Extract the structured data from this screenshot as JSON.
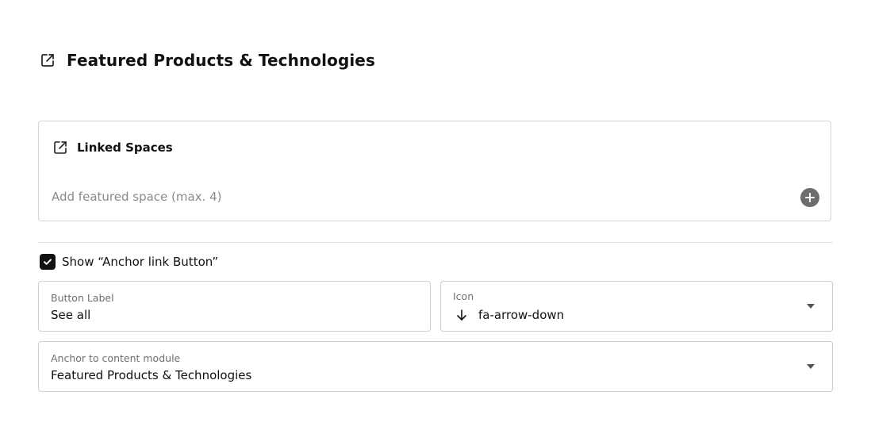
{
  "header": {
    "icon": "external-link-icon",
    "title": "Featured Products & Technologies"
  },
  "linked_spaces": {
    "icon": "external-link-icon",
    "title": "Linked Spaces",
    "placeholder": "Add featured space (max. 4)",
    "add_icon": "plus-circle-icon"
  },
  "anchor_button": {
    "checked": true,
    "label": "Show “Anchor link Button”"
  },
  "button_label_field": {
    "label": "Button Label",
    "value": "See all"
  },
  "icon_field": {
    "label": "Icon",
    "value": "fa-arrow-down",
    "value_icon": "arrow-down-icon"
  },
  "anchor_field": {
    "label": "Anchor to content module",
    "value": "Featured Products & Technologies"
  },
  "colors": {
    "text": "#111111",
    "muted": "#8a8a8a",
    "border": "#d4d4d4",
    "checkbox": "#111111",
    "add_button": "#6d6d6d"
  }
}
